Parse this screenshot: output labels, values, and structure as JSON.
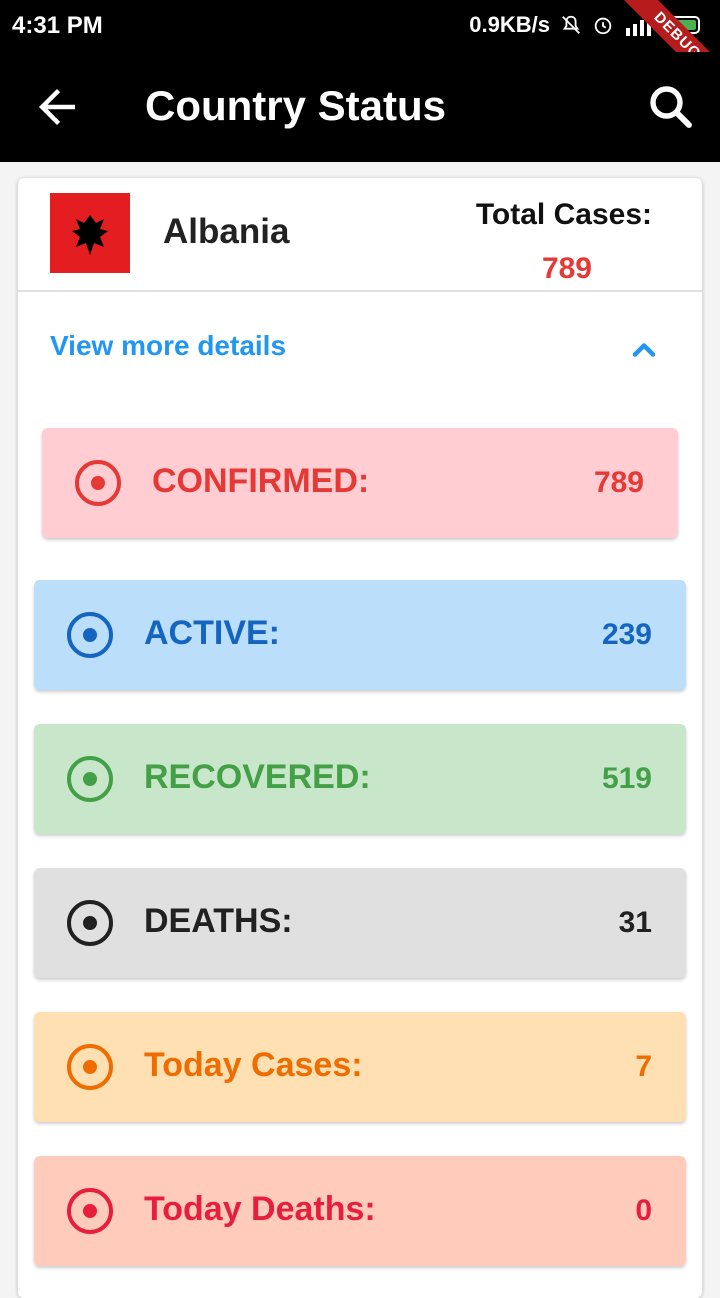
{
  "status_bar": {
    "time": "4:31 PM",
    "speed": "0.9KB/s",
    "debug_label": "DEBUG"
  },
  "app_bar": {
    "title": "Country Status",
    "back_icon": "arrow-back-icon",
    "search_icon": "search-icon"
  },
  "country": {
    "name": "Albania",
    "flag_icon": "albania-flag-icon",
    "total_label": "Total Cases:",
    "total_value": "789"
  },
  "details_toggle": {
    "label": "View more details",
    "icon": "chevron-up-icon"
  },
  "stats": [
    {
      "label": "CONFIRMED:",
      "value": "789",
      "color": "#e53935",
      "bg": "#ffcdd2"
    },
    {
      "label": "ACTIVE:",
      "value": "239",
      "color": "#1565c0",
      "bg": "#bbdefb"
    },
    {
      "label": "RECOVERED:",
      "value": "519",
      "color": "#43a047",
      "bg": "#c8e6c9"
    },
    {
      "label": "DEATHS:",
      "value": "31",
      "color": "#212121",
      "bg": "#e0e0e0"
    },
    {
      "label": "Today Cases:",
      "value": "7",
      "color": "#ef6c00",
      "bg": "#ffe0b2"
    },
    {
      "label": "Today Deaths:",
      "value": "0",
      "color": "#e91e3c",
      "bg": "#ffccbc"
    }
  ]
}
